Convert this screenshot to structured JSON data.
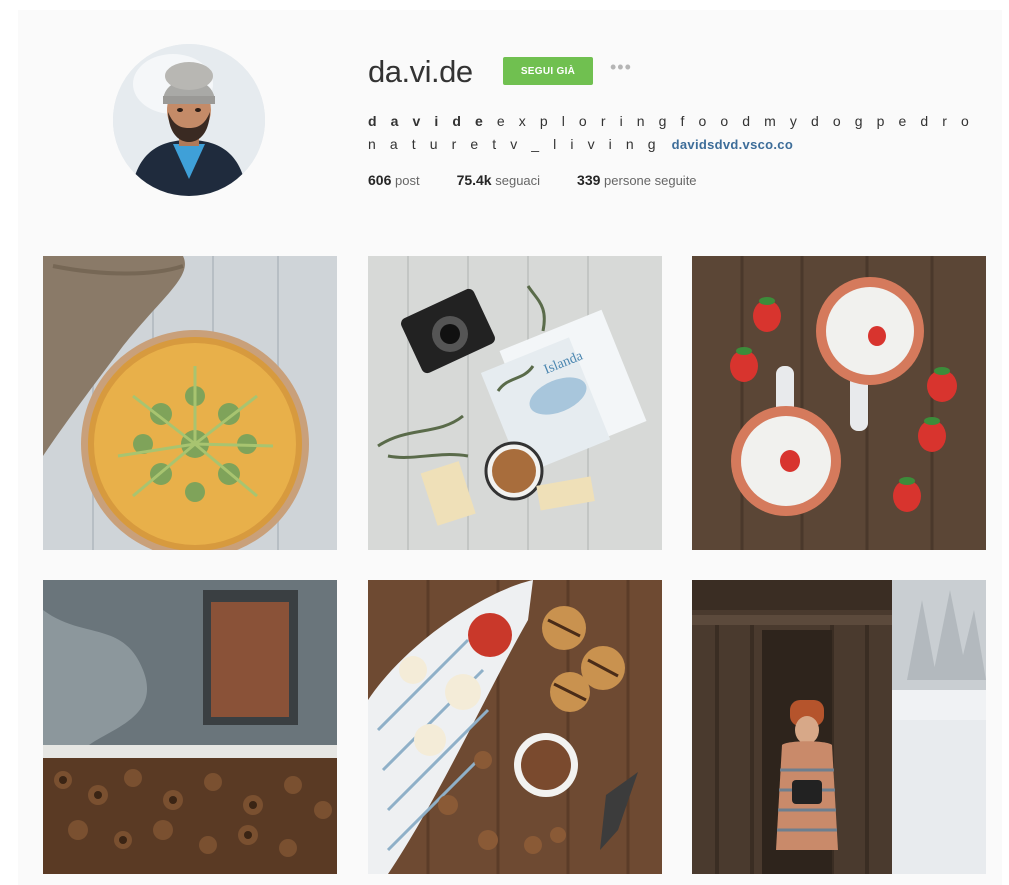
{
  "profile": {
    "username": "da.vi.de",
    "follow_label": "SEGUI GIÀ",
    "more_label": "•••",
    "bio_name": "d a v i d e",
    "bio_text": " e x p l o r i n g f o o d m y d o g p e d r o n a t u r e t v _ l i v i n g",
    "website": "davidsdvd.vsco.co",
    "stats": {
      "posts_count": "606",
      "posts_label": "post",
      "followers_count": "75.4k",
      "followers_label": "seguaci",
      "following_count": "339",
      "following_label": "persone seguite"
    }
  },
  "posts": [
    {
      "subject": "quiche with green onions"
    },
    {
      "subject": "camera, Islanda guidebook and coffee"
    },
    {
      "subject": "porridge bowls with strawberries"
    },
    {
      "subject": "rustic window and woodpile"
    },
    {
      "subject": "apples, cookies and coffee"
    },
    {
      "subject": "person in knitted sweater at snowy cabin"
    }
  ],
  "icons": {
    "more": "ellipsis-icon"
  }
}
